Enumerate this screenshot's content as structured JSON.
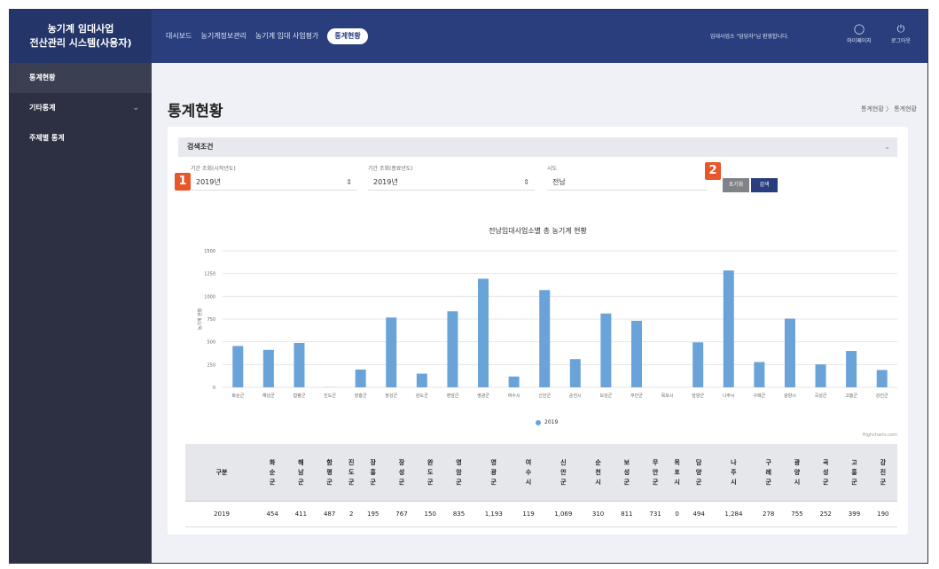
{
  "brand": {
    "line1": "농기계 임대사업",
    "line2": "전산관리 시스템(사용자)"
  },
  "nav": {
    "items": [
      "대시보드",
      "농기계정보관리",
      "농기계 임대 사업평가",
      "통계현황"
    ],
    "active_index": 3
  },
  "header": {
    "welcome": "임대사업소 \"담당자\"님 환영합니다.",
    "mypage_label": "마이페이지",
    "logout_label": "로그아웃"
  },
  "sidebar": {
    "items": [
      {
        "label": "통계현황",
        "active": true,
        "chevron": false
      },
      {
        "label": "기타통계",
        "active": false,
        "chevron": true
      },
      {
        "label": "주제별 통계",
        "active": false,
        "chevron": false
      }
    ]
  },
  "page": {
    "title": "통계현황",
    "breadcrumb": "통계현황 〉 통계현황"
  },
  "search": {
    "title": "검색조건",
    "start_label": "기간 조회(시작년도)",
    "start_value": "2019년",
    "end_label": "기간 조회(종료년도)",
    "end_value": "2019년",
    "sido_label": "시도",
    "sido_value": "전남",
    "reset_label": "초기화",
    "search_label": "검색",
    "badge1": "1",
    "badge2": "2"
  },
  "chart_data": {
    "type": "bar",
    "title": "전남임대사업소별 총 농기계 현황",
    "ylabel": "농기계 현황",
    "ylim": [
      0,
      1500
    ],
    "yticks": [
      0,
      250,
      500,
      750,
      1000,
      1250,
      1500
    ],
    "categories": [
      "화순군",
      "해남군",
      "함평군",
      "진도군",
      "장흥군",
      "장성군",
      "완도군",
      "영암군",
      "영광군",
      "여수시",
      "신안군",
      "순천시",
      "보성군",
      "무안군",
      "목포시",
      "담양군",
      "나주시",
      "구례군",
      "광양시",
      "곡성군",
      "고흥군",
      "강진군"
    ],
    "series": [
      {
        "name": "2019",
        "values": [
          454,
          411,
          487,
          2,
          195,
          767,
          150,
          835,
          1193,
          119,
          1069,
          310,
          811,
          731,
          0,
          494,
          1284,
          278,
          755,
          252,
          399,
          190
        ]
      }
    ],
    "color": "#6aa3d8",
    "legend": "bottom-center",
    "credit": "Highcharts.com"
  },
  "table": {
    "corner": "구분",
    "row_label": "2019",
    "values": [
      "454",
      "411",
      "487",
      "2",
      "195",
      "767",
      "150",
      "835",
      "1,193",
      "119",
      "1,069",
      "310",
      "811",
      "731",
      "0",
      "494",
      "1,284",
      "278",
      "755",
      "252",
      "399",
      "190"
    ]
  }
}
